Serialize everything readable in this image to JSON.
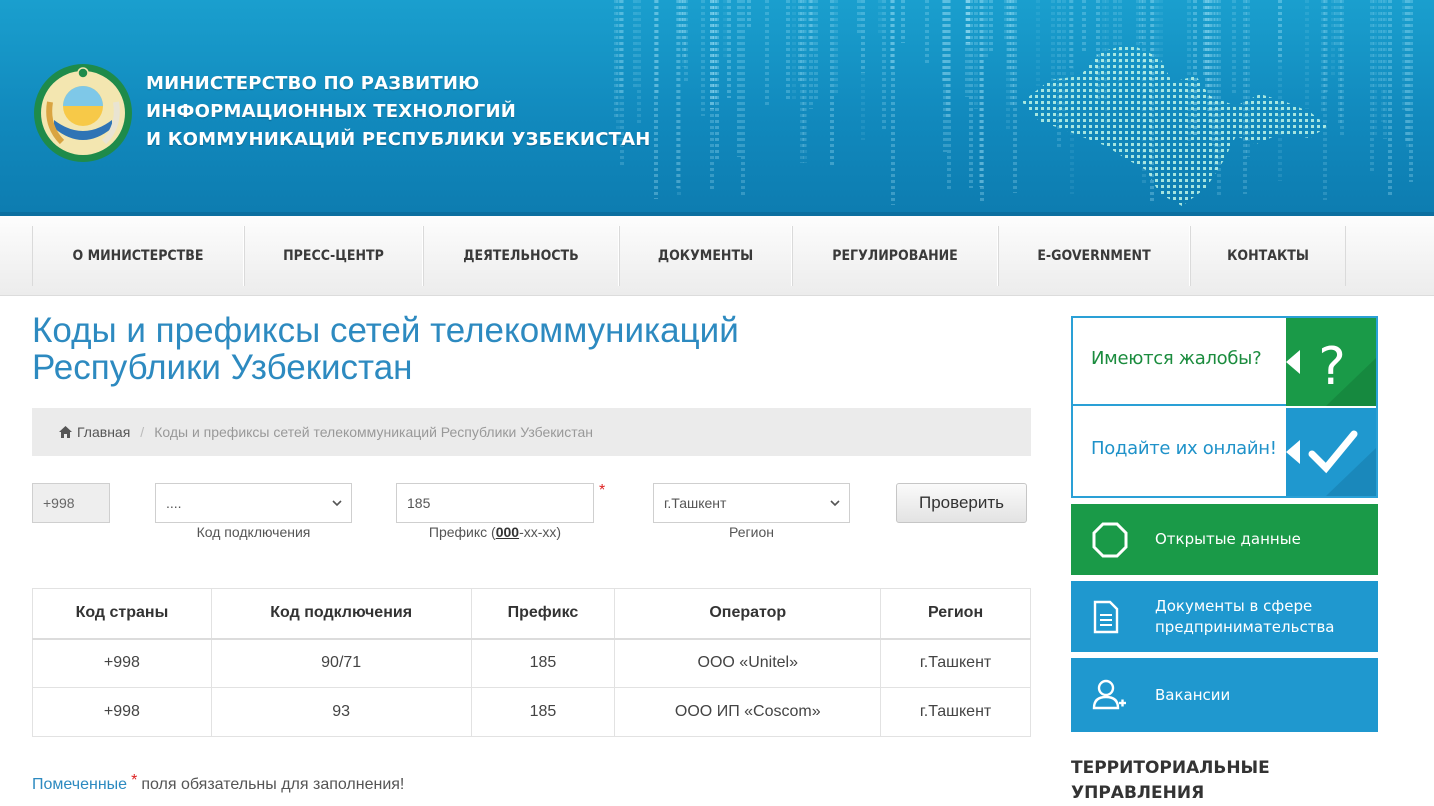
{
  "header": {
    "ministry_name": [
      "МИНИСТЕРСТВО ПО РАЗВИТИЮ",
      "ИНФОРМАЦИОННЫХ ТЕХНОЛОГИЙ",
      "И КОММУНИКАЦИЙ РЕСПУБЛИКИ УЗБЕКИСТАН"
    ]
  },
  "nav": {
    "items": [
      {
        "label": "О МИНИСТЕРСТВЕ"
      },
      {
        "label": "ПРЕСС-ЦЕНТР"
      },
      {
        "label": "ДЕЯТЕЛЬНОСТЬ"
      },
      {
        "label": "ДОКУМЕНТЫ"
      },
      {
        "label": "РЕГУЛИРОВАНИЕ"
      },
      {
        "label": "E-GOVERNMENT"
      },
      {
        "label": "КОНТАКТЫ"
      }
    ]
  },
  "main": {
    "title_line1": "Коды и префиксы сетей телекоммуникаций",
    "title_line2": "Республики Узбекистан",
    "breadcrumb": {
      "home": "Главная",
      "separator": "/",
      "current": "Коды и префиксы сетей телекоммуникаций Республики Узбекистан"
    },
    "form": {
      "country_code": "+998",
      "connection_code_value": "....",
      "connection_code_label": "Код подключения",
      "prefix_value": "185",
      "prefix_label_before": "Префикс (",
      "prefix_label_bold": "000",
      "prefix_label_after": "-xx-xx)",
      "required_star": "*",
      "region_value": "г.Ташкент",
      "region_label": "Регион",
      "submit_label": "Проверить"
    },
    "table": {
      "headers": [
        "Код страны",
        "Код подключения",
        "Префикс",
        "Оператор",
        "Регион"
      ],
      "rows": [
        [
          "+998",
          "90/71",
          "185",
          "ООО «Unitel»",
          "г.Ташкент"
        ],
        [
          "+998",
          "93",
          "185",
          "ООО ИП «Coscom»",
          "г.Ташкент"
        ]
      ]
    },
    "footnote": {
      "before": "Помеченные",
      "star": "*",
      "after": "поля обязательны для заполнения!"
    }
  },
  "sidebar": {
    "complaints_question": "Имеются жалобы?",
    "complaints_online": "Подайте их онлайн!",
    "open_data": "Открытые данные",
    "business_docs_line1": "Документы в сфере",
    "business_docs_line2": "предпринимательства",
    "vacancies": "Вакансии",
    "regional_heading_line1": "ТЕРРИТОРИАЛЬНЫЕ",
    "regional_heading_line2": "УПРАВЛЕНИЯ",
    "colors": {
      "green": "#1a9a48",
      "blue": "#1f98cf",
      "header_blue": "#1189bd"
    }
  }
}
